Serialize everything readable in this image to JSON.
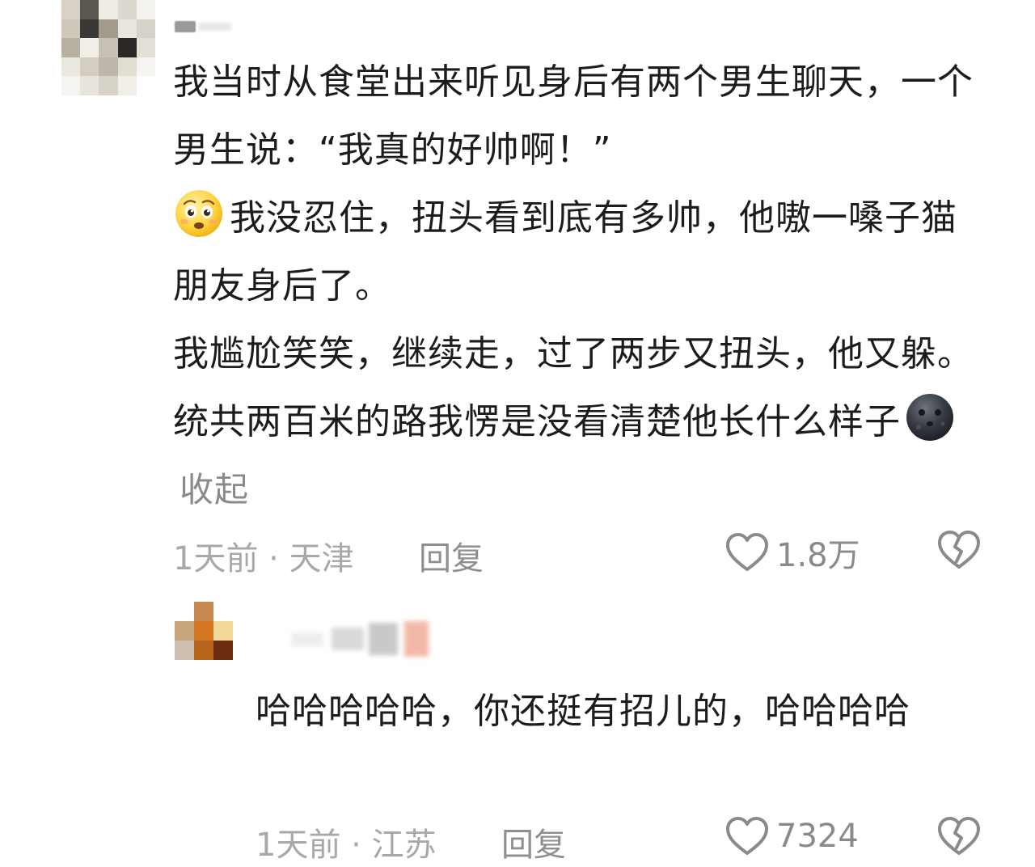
{
  "comment": {
    "text_lines": [
      "我当时从食堂出来听见身后有两个男生聊天，一个男生说：“我真的好帅啊！”",
      "我没忍住，扭头看到底有多帅，他嗷一嗓子猫朋友身后了。",
      "我尴尬笑笑，继续走，过了两步又扭头，他又躲。统共两百米的路我愣是没看清楚他长什么样子"
    ],
    "emoji_1": "sweat-face-icon",
    "emoji_2": "dark-moon-face-icon",
    "collapse_label": "收起",
    "time_location": "1天前 · 天津",
    "reply_label": "回复",
    "like_count": "1.8万"
  },
  "reply": {
    "text_lines": [
      "哈哈哈哈哈，你还挺有招儿的，哈哈哈哈"
    ],
    "time_location": "1天前 · 江苏",
    "reply_label": "回复",
    "like_count": "7324"
  },
  "colors": {
    "meta_text": "#a8a8a8",
    "body_text": "#1c1c1c"
  }
}
